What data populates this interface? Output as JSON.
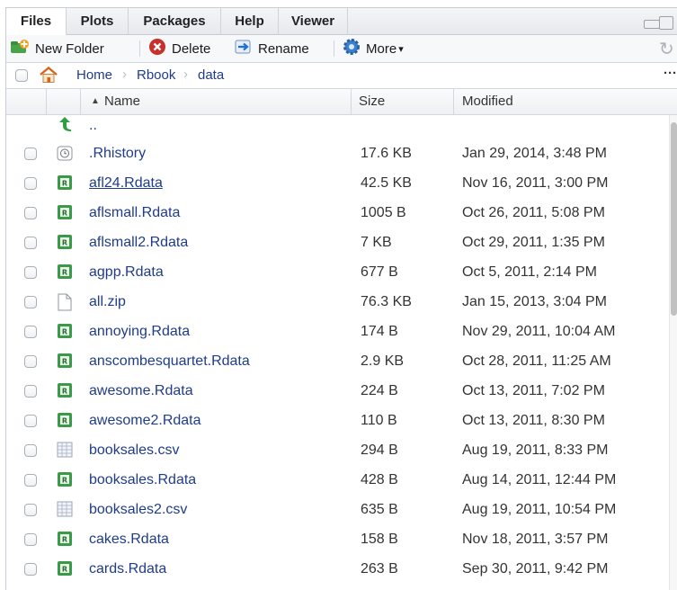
{
  "tabs": [
    "Files",
    "Plots",
    "Packages",
    "Help",
    "Viewer"
  ],
  "toolbar": {
    "new_folder": "New Folder",
    "delete": "Delete",
    "rename": "Rename",
    "more": "More",
    "more_caret": "▾",
    "refresh_icon": "↻"
  },
  "breadcrumb": [
    "Home",
    "Rbook",
    "data"
  ],
  "breadcrumb_sep": "›",
  "overflow_label": "···",
  "columns": {
    "sort_arrow": "▲",
    "name": "Name",
    "size": "Size",
    "modified": "Modified"
  },
  "parent_dir": "..",
  "files": [
    {
      "name": ".Rhistory",
      "size": "17.6 KB",
      "modified": "Jan 29, 2014, 3:48 PM",
      "icon": "history-icon"
    },
    {
      "name": "afl24.Rdata",
      "size": "42.5 KB",
      "modified": "Nov 16, 2011, 3:00 PM",
      "icon": "rdata-icon"
    },
    {
      "name": "aflsmall.Rdata",
      "size": "1005 B",
      "modified": "Oct 26, 2011, 5:08 PM",
      "icon": "rdata-icon"
    },
    {
      "name": "aflsmall2.Rdata",
      "size": "7 KB",
      "modified": "Oct 29, 2011, 1:35 PM",
      "icon": "rdata-icon"
    },
    {
      "name": "agpp.Rdata",
      "size": "677 B",
      "modified": "Oct 5, 2011, 2:14 PM",
      "icon": "rdata-icon"
    },
    {
      "name": "all.zip",
      "size": "76.3 KB",
      "modified": "Jan 15, 2013, 3:04 PM",
      "icon": "file-icon"
    },
    {
      "name": "annoying.Rdata",
      "size": "174 B",
      "modified": "Nov 29, 2011, 10:04 AM",
      "icon": "rdata-icon"
    },
    {
      "name": "anscombesquartet.Rdata",
      "size": "2.9 KB",
      "modified": "Oct 28, 2011, 11:25 AM",
      "icon": "rdata-icon"
    },
    {
      "name": "awesome.Rdata",
      "size": "224 B",
      "modified": "Oct 13, 2011, 7:02 PM",
      "icon": "rdata-icon"
    },
    {
      "name": "awesome2.Rdata",
      "size": "110 B",
      "modified": "Oct 13, 2011, 8:30 PM",
      "icon": "rdata-icon"
    },
    {
      "name": "booksales.csv",
      "size": "294 B",
      "modified": "Aug 19, 2011, 8:33 PM",
      "icon": "csv-icon"
    },
    {
      "name": "booksales.Rdata",
      "size": "428 B",
      "modified": "Aug 14, 2011, 12:44 PM",
      "icon": "rdata-icon"
    },
    {
      "name": "booksales2.csv",
      "size": "635 B",
      "modified": "Aug 19, 2011, 10:54 PM",
      "icon": "csv-icon"
    },
    {
      "name": "cakes.Rdata",
      "size": "158 B",
      "modified": "Nov 18, 2011, 3:57 PM",
      "icon": "rdata-icon"
    },
    {
      "name": "cards.Rdata",
      "size": "263 B",
      "modified": "Sep 30, 2011, 9:42 PM",
      "icon": "rdata-icon"
    }
  ],
  "colors": {
    "link": "#1f3c8c",
    "rdata_green": "#3a9a4a",
    "up_arrow_green": "#2e9e3e",
    "home_orange": "#d9621c",
    "delete_red": "#c9302c",
    "folder_green": "#3a8f3a"
  }
}
